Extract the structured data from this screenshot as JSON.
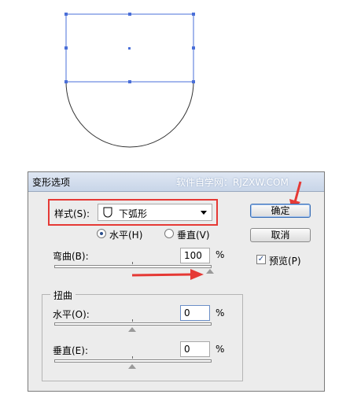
{
  "dialog": {
    "title": "变形选项",
    "watermark": "软件自学网：RJZXW.COM",
    "style_label": "样式(S):",
    "style_value": "下弧形",
    "orientation": {
      "horizontal_label": "水平(H)",
      "vertical_label": "垂直(V)",
      "selected": "horizontal"
    },
    "bend": {
      "label": "弯曲(B):",
      "value": "100",
      "unit": "%",
      "slider_fraction": 1.0
    },
    "distortion": {
      "group_title": "扭曲",
      "horizontal": {
        "label": "水平(O):",
        "value": "0",
        "unit": "%",
        "slider_fraction": 0.5
      },
      "vertical": {
        "label": "垂直(E):",
        "value": "0",
        "unit": "%",
        "slider_fraction": 0.5
      }
    },
    "buttons": {
      "ok": "确定",
      "cancel": "取消"
    },
    "preview": {
      "label": "预览(P)",
      "checked": true
    }
  },
  "colors": {
    "selection": "#4a6fd8",
    "annotation": "#e53935"
  }
}
